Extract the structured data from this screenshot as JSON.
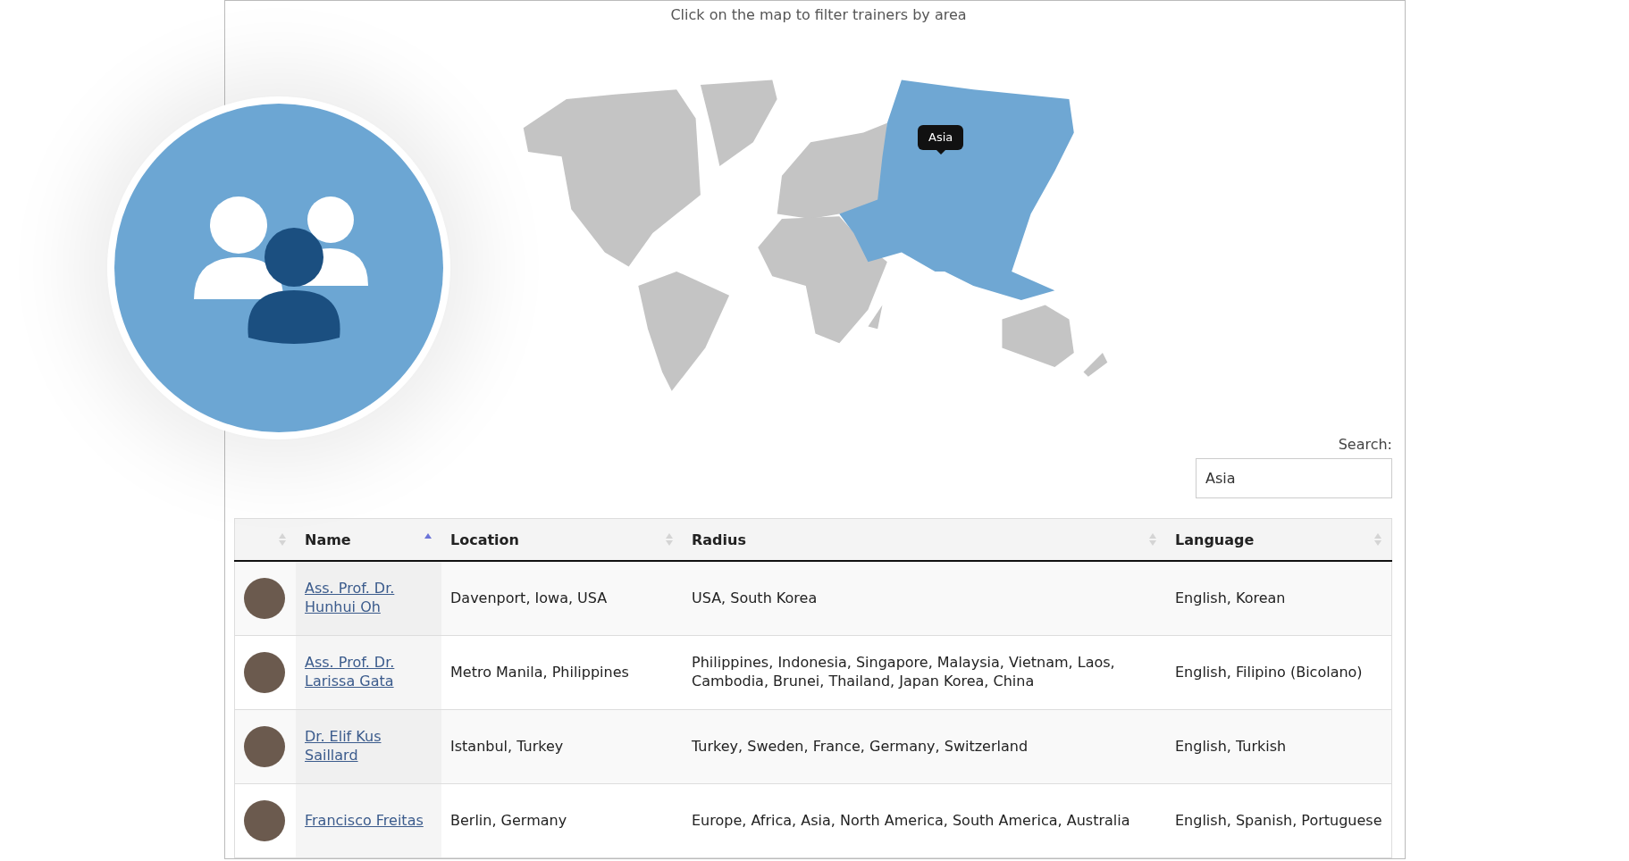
{
  "caption": "Click on the map to filter trainers by area",
  "map": {
    "regions": [
      {
        "kind": "north_america",
        "selected": false
      },
      {
        "kind": "greenland",
        "selected": false
      },
      {
        "kind": "south_america",
        "selected": false
      },
      {
        "kind": "europe",
        "selected": false
      },
      {
        "kind": "africa",
        "selected": false
      },
      {
        "kind": "asia",
        "selected": true
      },
      {
        "kind": "oceania",
        "selected": false
      }
    ],
    "tooltip": "Asia"
  },
  "search": {
    "label": "Search:",
    "value": "Asia"
  },
  "table": {
    "columns": [
      {
        "sorted": false
      },
      {
        "label": "Name",
        "sorted": true
      },
      {
        "label": "Location",
        "sorted": false
      },
      {
        "label": "Radius",
        "sorted": false
      },
      {
        "label": "Language",
        "sorted": false
      }
    ],
    "rows": [
      {
        "name": "Ass. Prof. Dr. Hunhui Oh",
        "location": "Davenport, Iowa, USA",
        "radius": "USA, South Korea",
        "language": "English, Korean"
      },
      {
        "name": "Ass. Prof. Dr. Larissa Gata",
        "location": "Metro Manila, Philippines",
        "radius": "Philippines, Indonesia, Singapore, Malaysia, Vietnam, Laos, Cambodia, Brunei, Thailand, Japan Korea, China",
        "language": "English, Filipino (Bicolano)"
      },
      {
        "name": "Dr. Elif Kus Saillard",
        "location": "Istanbul, Turkey",
        "radius": "Turkey, Sweden, France, Germany, Switzerland",
        "language": "English, Turkish"
      },
      {
        "name": "Francisco Freitas",
        "location": "Berlin, Germany",
        "radius": "Europe, Africa, Asia, North America, South America, Australia",
        "language": "English, Spanish, Portuguese"
      }
    ]
  }
}
